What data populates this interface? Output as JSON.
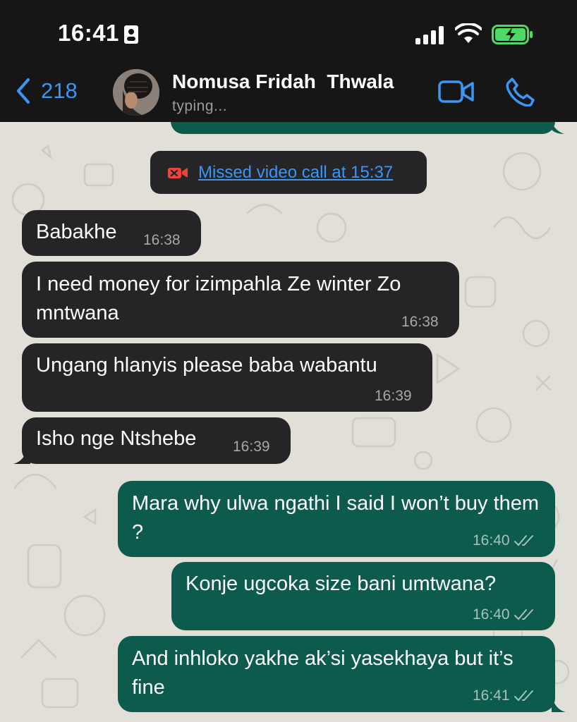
{
  "status_bar": {
    "time": "16:41"
  },
  "header": {
    "back_count": "218",
    "contact_name": "Nomusa Fridah  Thwala",
    "contact_status": "typing..."
  },
  "system_message": {
    "text": "Missed video call at 15:37",
    "icon": "missed-video-call-icon"
  },
  "messages": [
    {
      "direction": "incoming",
      "text": "Babakhe",
      "time": "16:38"
    },
    {
      "direction": "incoming",
      "text": "I need money for izimpahla Ze winter Zo mntwana",
      "time": "16:38"
    },
    {
      "direction": "incoming",
      "text": "Ungang hlanyis please baba wabantu",
      "time": "16:39"
    },
    {
      "direction": "incoming",
      "text": "Isho nge Ntshebe",
      "time": "16:39"
    },
    {
      "direction": "outgoing",
      "text": "Mara why ulwa ngathi I said I won’t buy them ?",
      "time": "16:40",
      "status": "read"
    },
    {
      "direction": "outgoing",
      "text": "Konje ugcoka size bani umtwana?",
      "time": "16:40",
      "status": "read"
    },
    {
      "direction": "outgoing",
      "text": "And inhloko yakhe ak’si yasekhaya but it’s fine",
      "time": "16:41",
      "status": "read"
    }
  ],
  "colors": {
    "accent": "#3b96f4",
    "incoming_bubble": "#252427",
    "outgoing_bubble": "#0c5b4c",
    "header_bg": "#161616",
    "chat_bg": "#e2dfd8",
    "battery": "#4cd964"
  }
}
